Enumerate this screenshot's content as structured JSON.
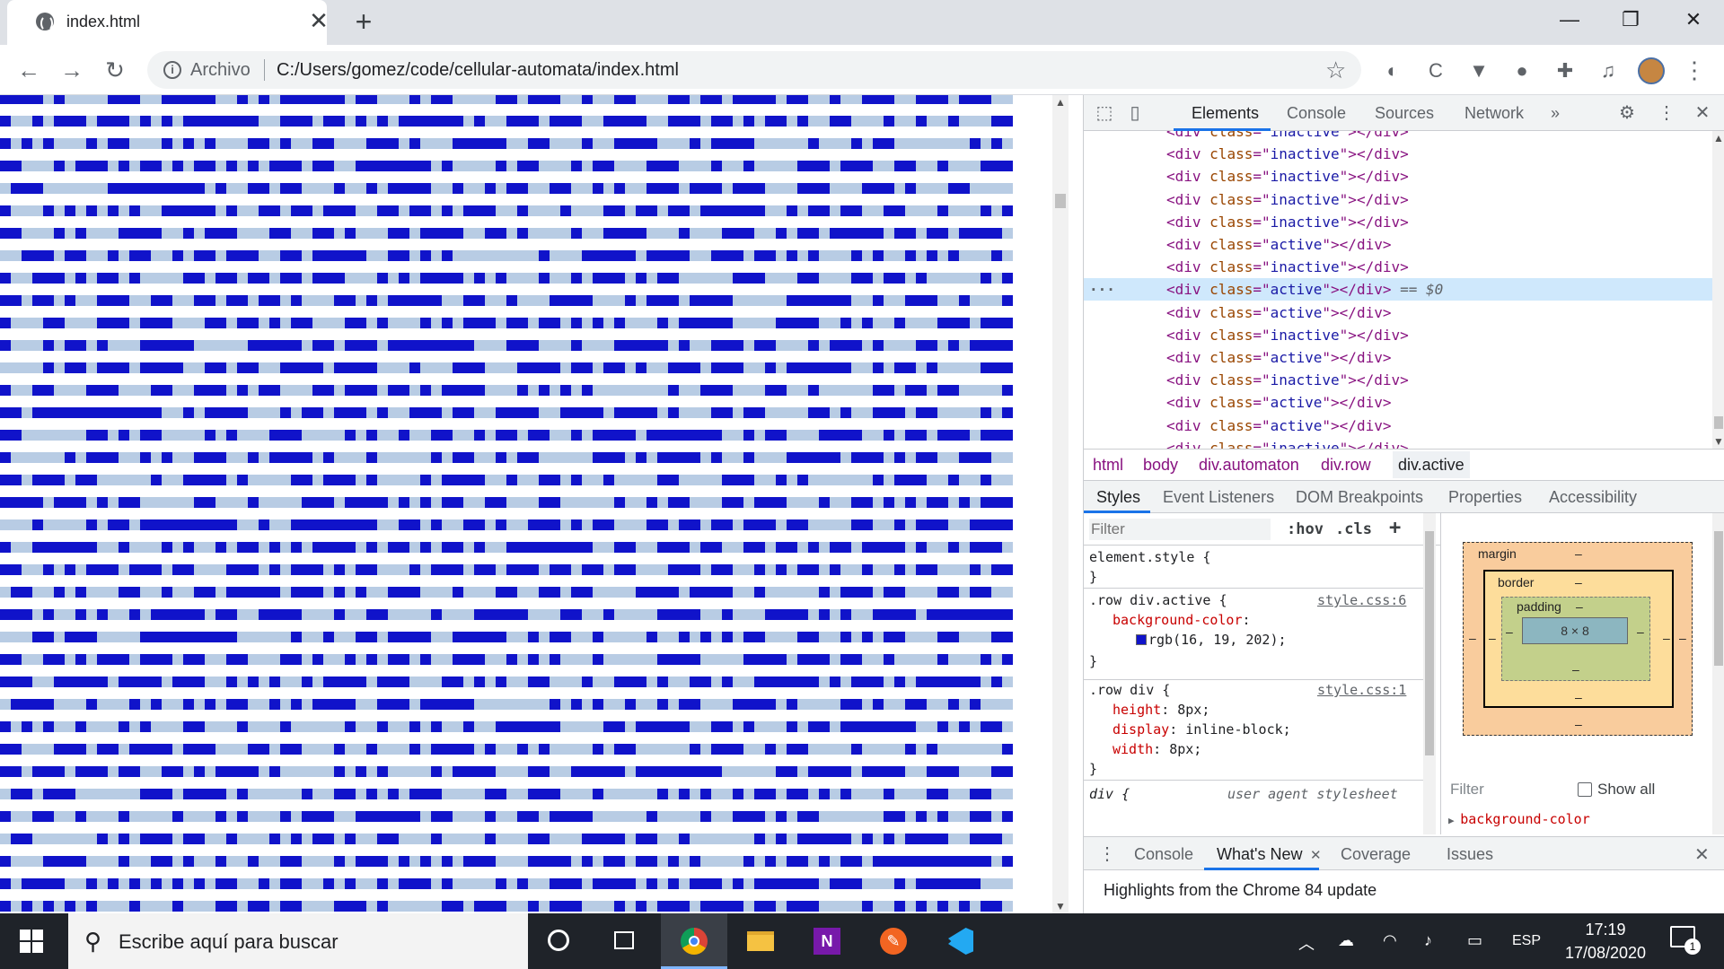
{
  "browser": {
    "tab_title": "index.html",
    "tab_close": "✕",
    "new_tab": "+",
    "site_label": "Archivo",
    "url": "C:/Users/gomez/code/cellular-automata/index.html",
    "window_controls": {
      "minimize": "—",
      "restore": "❐",
      "close": "✕"
    },
    "extension_icons": [
      "ghost-extension-icon",
      "code-extension-icon",
      "v-extension-icon",
      "tomato-timer-icon",
      "extensions-puzzle-icon",
      "media-queue-icon"
    ]
  },
  "colors": {
    "active_cell": "#1013ca",
    "inactive_cell": "#b8cce4",
    "accent": "#1a73e8"
  },
  "automaton": {
    "rows": [
      "1111010000111001111100101011111101100010110000110111001001100011011011110110010011100111011100",
      "1001011101110101011111110011101101010111111010011101110011110011101101011010011000100100100011",
      "1010100010110001010100011010011000111010001111100110001001111000101111000001000101100000001010",
      "1100010111010110101101010111011001111111010000101100010110001110001001000011101110011001000111",
      "0111000000111111111010011011000100101111001001011001100101001110111011100011100011101000110000",
      "1000101010101001111101001101101110011011010111001000100011011011011111100101101100110001000101",
      "1100010100011110010111000110011010001101111001101000010011110001000111001011011111011011011110",
      "0011101100101100101101110011011111001101010000000010001111101111001110110101000101001010100010",
      "1001110101101000011011011011011100010101111010100010010111010110000011100011000110110100000101",
      "1101101001110011001101101101000110101111100110010001111000101110111100000111111001001110010001",
      "1000110001110111000110110101100011010001010111011011010101000101111100001111001010010001110111",
      "1000101101000111110000011111011011101111111100011100010001111101001110110001011101000110101111",
      "0000101101110111100110110011110111100010001110001111011011010011101110010111111001011010000111",
      "1001100011100011001110101100011011101101011110001010101000000010011100011001000001101101100001",
      "1101111111111110010111100010110111010011101100111100111101111010001101100001101001110110000101",
      "1100000011010110000101000111000010100100110010110110010111101111111001011000111100101101110111",
      "1000001011100101001110010111101000100000101100101100000111010111101001000111110111010110011100",
      "1101110110000010011110100001101110100001011110010011010010000110000111001010000001011100100100",
      "1111011101011000001100010000111011110101011001100011000001001011000110111000100110101011010111",
      "0001000010110111111111001001111111100110100110100111010110001101101101110110000110010111001111",
      "1001111110010001010010110101011110101101011010011111111001100111011001101101011011110100101110",
      "1100101011101110110001110101110101100010111011011101101101100011101100101011010010010110001011",
      "0110010100011001001101111101110101001110001000110011011000011110111100100000101110110001101100",
      "1110100101001011111011001111000100110000100011111000110010000111100100011110101001111011111111",
      "0001101110000111111111000001001001101111001111100101100100001001010101100011001010110001100011",
      "1100110101110111011001100011010010101101001110010101000100000111100001111011101100100001000101",
      "1110011111011110111001010100101111011100011010100110001001110100110100111111010111010111111010",
      "0111100010001010010101100101011110011101111100000001010100100101100011110100001101001100101000",
      "1010100100010100011000100010000010010010100100111111000011011111001101000101101111111001010110",
      "1100011101101111011100011011000100100010111101001010000101100000101110010110000100001010000001",
      "1101110111011001101011110100000101010000101111000110011111011111111000001101111011110011100011",
      "0110111000000111011110100000100110101011100001100111000100000101010010110110101000100011001100",
      "1001100100010000100010100010111001111110110001001101111000001000010011101011000000110101001101",
      "0110000001010111011001000101011010011000100001000110001111011001000000101011111010101111001110",
      "1000111100010011010010010011000101110101010111000111101011011010100001010110101101111111111101",
      "1011110010101010101011001011001010010111010000101001110111101010111010111111011100010111111000",
      "1010101010001000100011011011000111010000011011100101110001010111011110110111000010010101010110"
    ]
  },
  "devtools": {
    "tabs": [
      "Elements",
      "Console",
      "Sources",
      "Network"
    ],
    "more_tabs": "»",
    "icons": {
      "inspect": "inspect-element-icon",
      "device": "device-toolbar-icon",
      "settings": "settings-gear-icon",
      "menu": "kebab-menu-icon",
      "close": "close-devtools-icon"
    },
    "dom_lines": [
      {
        "cls": "inactive",
        "selected": false
      },
      {
        "cls": "inactive",
        "selected": false
      },
      {
        "cls": "inactive",
        "selected": false
      },
      {
        "cls": "inactive",
        "selected": false
      },
      {
        "cls": "inactive",
        "selected": false
      },
      {
        "cls": "active",
        "selected": false
      },
      {
        "cls": "inactive",
        "selected": false
      },
      {
        "cls": "active",
        "selected": true
      },
      {
        "cls": "active",
        "selected": false
      },
      {
        "cls": "inactive",
        "selected": false
      },
      {
        "cls": "active",
        "selected": false
      },
      {
        "cls": "inactive",
        "selected": false
      },
      {
        "cls": "active",
        "selected": false
      },
      {
        "cls": "active",
        "selected": false
      },
      {
        "cls": "inactive",
        "selected": false
      }
    ],
    "dom_parts": {
      "open": "<div ",
      "attr": "class",
      "eq": "=\"",
      "close": "\"></div>",
      "selected_ref": "== $0",
      "dots": "···"
    },
    "breadcrumbs": [
      "html",
      "body",
      "div.automaton",
      "div.row",
      "div.active"
    ],
    "sub_tabs": [
      "Styles",
      "Event Listeners",
      "DOM Breakpoints",
      "Properties",
      "Accessibility"
    ],
    "styles": {
      "filter_placeholder": "Filter",
      "hov": ":hov",
      "cls": ".cls",
      "plus": "+",
      "element_style": "element.style {",
      "close_brace": "}",
      "rule1": {
        "selector": ".row div.active {",
        "source": "style.css:6",
        "prop": "background-color",
        "value": "rgb(16, 19, 202);"
      },
      "rule2": {
        "selector": ".row div {",
        "source": "style.css:1",
        "decls": [
          {
            "prop": "height",
            "value": "8px;"
          },
          {
            "prop": "display",
            "value": "inline-block;"
          },
          {
            "prop": "width",
            "value": "8px;"
          }
        ]
      },
      "ua_rule": {
        "selector": "div {",
        "source": "user agent stylesheet"
      }
    },
    "box_model": {
      "margin": "margin",
      "border": "border",
      "padding": "padding",
      "dash": "–",
      "content": "8 × 8"
    },
    "computed": {
      "filter_placeholder": "Filter",
      "show_all": "Show all",
      "first_prop": "background-color"
    },
    "drawer": {
      "tabs": [
        "Console",
        "What's New",
        "Coverage",
        "Issues"
      ],
      "whats_new_close": "✕",
      "message": "Highlights from the Chrome 84 update"
    }
  },
  "taskbar": {
    "search_placeholder": "Escribe aquí para buscar",
    "apps": [
      "cortana-icon",
      "task-view-icon",
      "chrome-icon",
      "file-explorer-icon",
      "onenote-icon",
      "pen-app-icon",
      "vscode-icon"
    ],
    "language": "ESP",
    "time": "17:19",
    "date": "17/08/2020",
    "notification_count": "1"
  }
}
